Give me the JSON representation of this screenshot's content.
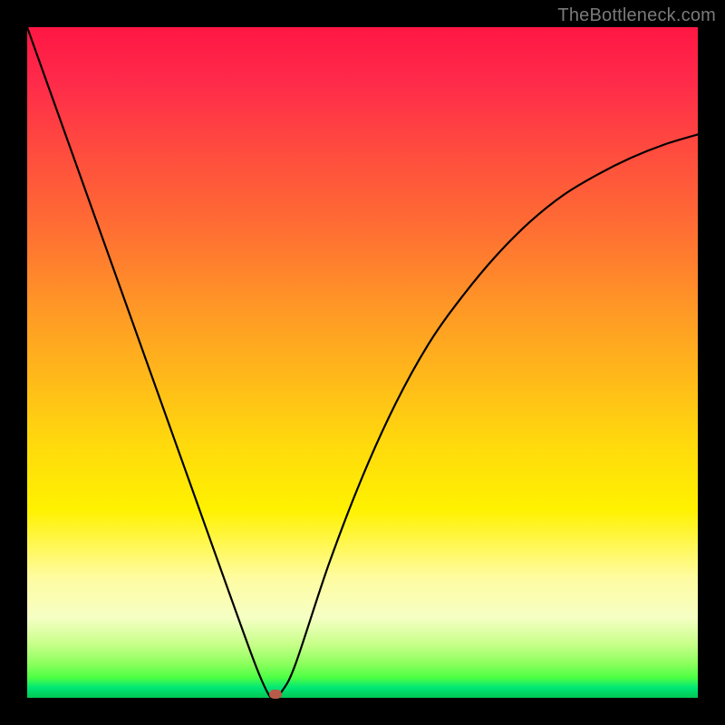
{
  "watermark": "TheBottleneck.com",
  "chart_data": {
    "type": "line",
    "title": "",
    "xlabel": "",
    "ylabel": "",
    "xlim": [
      0,
      100
    ],
    "ylim": [
      0,
      100
    ],
    "series": [
      {
        "name": "curve",
        "x": [
          0,
          5,
          10,
          15,
          20,
          25,
          30,
          34,
          36,
          37,
          38,
          40,
          45,
          50,
          55,
          60,
          65,
          70,
          75,
          80,
          85,
          90,
          95,
          100
        ],
        "y": [
          100,
          86,
          72,
          58,
          44,
          30,
          16,
          5,
          0.5,
          0,
          1,
          5,
          20,
          33,
          44,
          53,
          60,
          66,
          71,
          75,
          78,
          80.5,
          82.5,
          84
        ]
      }
    ],
    "marker": {
      "x": 37,
      "y": 0.5
    },
    "background": {
      "type": "vertical-gradient",
      "stops": [
        {
          "pos": 0,
          "color": "#ff1744"
        },
        {
          "pos": 50,
          "color": "#ffd500"
        },
        {
          "pos": 100,
          "color": "#00c853"
        }
      ]
    }
  }
}
